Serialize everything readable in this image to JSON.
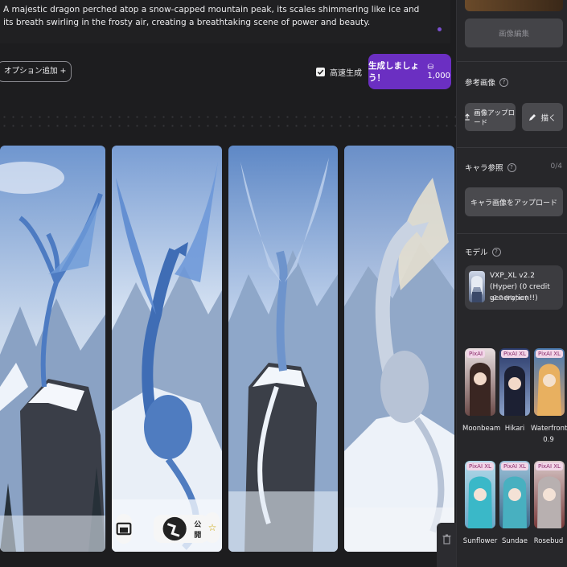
{
  "prompt": {
    "text": "A majestic dragon perched atop a snow-capped mountain peak, its scales shimmering like ice and its breath swirling in the frosty air, creating a breathtaking scene of power and beauty."
  },
  "options": {
    "add_label": "オプション追加 +"
  },
  "fast_generation": {
    "label": "高速生成",
    "checked": true
  },
  "generate": {
    "label": "生成しましょう！",
    "cost": "1,000"
  },
  "image_buttons": {
    "public_label": "公開"
  },
  "sidebar": {
    "edit_button": "画像編集",
    "reference": {
      "title": "参考画像",
      "upload_label": "画像アップロード",
      "draw_label": "描く"
    },
    "character": {
      "title": "キャラ参照",
      "count": "0/4",
      "upload_label": "キャラ画像をアップロード"
    },
    "model": {
      "title": "モデル",
      "name": "VXP_XL v2.2 (Hyper) (0 credit generation!!)",
      "version": "v2.2 (Hyper)"
    },
    "styles": [
      {
        "badge": "PixAI",
        "name": "Moonbeam"
      },
      {
        "badge": "PixAI XL",
        "name": "Hikari"
      },
      {
        "badge": "PixAI XL",
        "name": "Waterfront 0.9"
      },
      {
        "badge": "PixAI XL",
        "name": "Sunflower"
      },
      {
        "badge": "PixAI XL",
        "name": "Sundae"
      },
      {
        "badge": "PixAI XL",
        "name": "Rosebud"
      }
    ]
  },
  "colors": {
    "accent": "#6b2fc2",
    "panel": "#27272a",
    "background": "#1d1d1f"
  }
}
